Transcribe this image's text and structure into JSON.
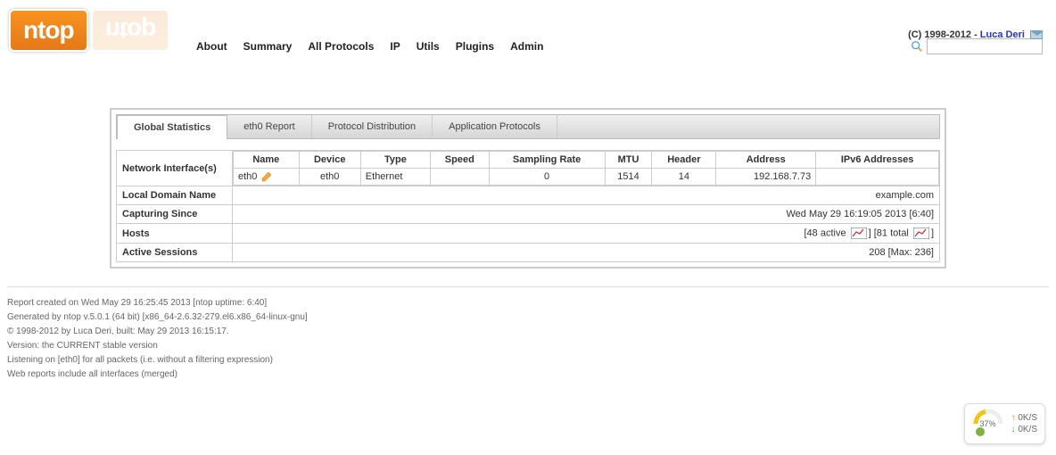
{
  "brand": "ntop",
  "copyright_prefix": "(C) 1998-2012 - ",
  "copyright_author": "Luca Deri",
  "nav": [
    "About",
    "Summary",
    "All Protocols",
    "IP",
    "Utils",
    "Plugins",
    "Admin"
  ],
  "search_placeholder": "",
  "tabs": [
    "Global Statistics",
    "eth0 Report",
    "Protocol Distribution",
    "Application Protocols"
  ],
  "active_tab": 0,
  "stats": {
    "interfaces_label": "Network Interface(s)",
    "iface_headers": [
      "Name",
      "Device",
      "Type",
      "Speed",
      "Sampling Rate",
      "MTU",
      "Header",
      "Address",
      "IPv6 Addresses"
    ],
    "iface_row": {
      "name": "eth0",
      "device": "eth0",
      "type": "Ethernet",
      "speed": "",
      "sampling_rate": "0",
      "mtu": "1514",
      "header": "14",
      "address": "192.168.7.73",
      "ipv6": ""
    },
    "rows": {
      "local_domain_label": "Local Domain Name",
      "local_domain_value": "example.com",
      "capturing_since_label": "Capturing Since",
      "capturing_since_value": "Wed May 29 16:19:05 2013 [6:40]",
      "hosts_label": "Hosts",
      "hosts_active": "[48 active ",
      "hosts_total_sep": "] [81 total ",
      "hosts_end": "]",
      "sessions_label": "Active Sessions",
      "sessions_value": "208 [Max: 236]"
    }
  },
  "footer": [
    "Report created on Wed May 29 16:25:45 2013 [ntop uptime: 6:40]",
    "Generated by ntop v.5.0.1 (64 bit) [x86_64-2.6.32-279.el6.x86_64-linux-gnu]",
    "© 1998-2012 by Luca Deri, built: May 29 2013 16:15:17.",
    "Version: the CURRENT stable version",
    "Listening on [eth0] for all packets (i.e. without a filtering expression)",
    "Web reports include all interfaces (merged)"
  ],
  "gauge": {
    "percent": "37%",
    "up_rate": "0K/S",
    "down_rate": "0K/S"
  }
}
